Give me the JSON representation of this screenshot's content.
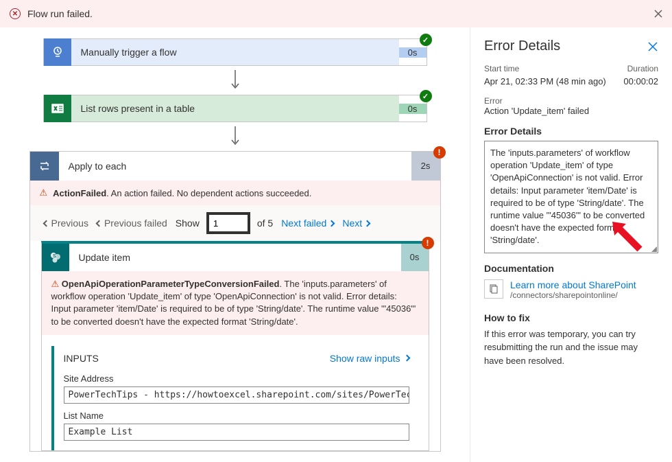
{
  "banner": {
    "text": "Flow run failed."
  },
  "steps": {
    "trigger": {
      "title": "Manually trigger a flow",
      "time": "0s"
    },
    "excel": {
      "title": "List rows present in a table",
      "time": "0s"
    },
    "loop": {
      "title": "Apply to each",
      "time": "2s"
    },
    "sp": {
      "title": "Update item",
      "time": "0s"
    }
  },
  "actionFailed": {
    "bold": "ActionFailed",
    "rest": ". An action failed. No dependent actions succeeded."
  },
  "pagination": {
    "previous": "Previous",
    "previousFailed": "Previous failed",
    "show": "Show",
    "value": "1",
    "of": "of 5",
    "nextFailed": "Next failed",
    "next": "Next"
  },
  "opError": {
    "title": "OpenApiOperationParameterTypeConversionFailed",
    "body": ". The 'inputs.parameters' of workflow operation 'Update_item' of type 'OpenApiConnection' is not valid. Error details: Input parameter 'item/Date' is required to be of type 'String/date'. The runtime value '\"45036\"' to be converted doesn't have the expected format 'String/date'."
  },
  "inputs": {
    "heading": "INPUTS",
    "showRaw": "Show raw inputs",
    "siteAddressLabel": "Site Address",
    "siteAddressValue": "PowerTechTips - https://howtoexcel.sharepoint.com/sites/PowerTechTips",
    "listNameLabel": "List Name",
    "listNameValue": "Example List"
  },
  "panel": {
    "title": "Error Details",
    "startLabel": "Start time",
    "startValue": "Apr 21, 02:33 PM (48 min ago)",
    "durationLabel": "Duration",
    "durationValue": "00:00:02",
    "errorLabel": "Error",
    "errorValue": "Action 'Update_item' failed",
    "detailsLabel": "Error Details",
    "detailsText": "The 'inputs.parameters' of workflow operation 'Update_item' of type 'OpenApiConnection' is not valid. Error details: Input parameter 'item/Date' is required to be of type 'String/date'. The runtime value '\"45036\"' to be converted doesn't have the expected format 'String/date'.",
    "docLabel": "Documentation",
    "docLink": "Learn more about SharePoint",
    "docPath": "/connectors/sharepointonline/",
    "howtoLabel": "How to fix",
    "howtoText": "If this error was temporary, you can try resubmitting the run and the issue may have been resolved."
  }
}
